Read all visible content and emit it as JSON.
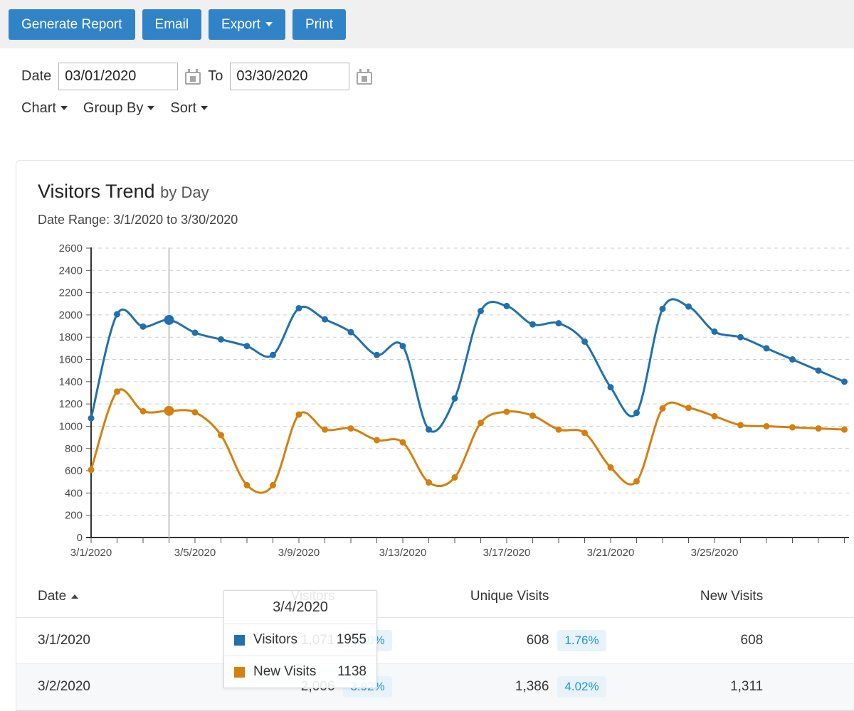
{
  "toolbar": {
    "buttons": [
      {
        "label": "Generate Report",
        "caret": false
      },
      {
        "label": "Email",
        "caret": false
      },
      {
        "label": "Export",
        "caret": true
      },
      {
        "label": "Print",
        "caret": false
      }
    ]
  },
  "filters": {
    "date_label": "Date",
    "date_from": "03/01/2020",
    "to_label": "To",
    "date_to": "03/30/2020",
    "date_placeholder": "mm/dd/yyyy",
    "menus": [
      {
        "label": "Chart"
      },
      {
        "label": "Group By"
      },
      {
        "label": "Sort"
      }
    ]
  },
  "card": {
    "title_main": "Visitors Trend",
    "title_sub": "by Day",
    "range_text": "Date Range: 3/1/2020 to 3/30/2020"
  },
  "tooltip": {
    "date": "3/4/2020",
    "rows": [
      {
        "name": "Visitors",
        "value": "1955",
        "color": "#2170ae"
      },
      {
        "name": "New Visits",
        "value": "1138",
        "color": "#d4800e"
      }
    ]
  },
  "colors": {
    "visitors": "#2170ae",
    "new_visits": "#d4800e",
    "button": "#3183c8",
    "toolbar_bg": "#f0f0f0",
    "badge_bg": "#e8f2fb",
    "badge_text": "#2196d3",
    "grid": "#cccccc",
    "axis": "#333333"
  },
  "chart_data": {
    "type": "line",
    "title": "Visitors Trend by Day",
    "subtitle": "Date Range: 3/1/2020 to 3/30/2020",
    "xlabel": "",
    "ylabel": "",
    "ylim": [
      0,
      2600
    ],
    "ytick_step": 200,
    "yticks": [
      0,
      200,
      400,
      600,
      800,
      1000,
      1200,
      1400,
      1600,
      1800,
      2000,
      2200,
      2400,
      2600
    ],
    "grid": true,
    "legend": "tooltip",
    "x": [
      "3/1/2020",
      "3/2/2020",
      "3/3/2020",
      "3/4/2020",
      "3/5/2020",
      "3/6/2020",
      "3/7/2020",
      "3/8/2020",
      "3/9/2020",
      "3/10/2020",
      "3/11/2020",
      "3/12/2020",
      "3/13/2020",
      "3/14/2020",
      "3/15/2020",
      "3/16/2020",
      "3/17/2020",
      "3/18/2020",
      "3/19/2020",
      "3/20/2020",
      "3/21/2020",
      "3/22/2020",
      "3/23/2020",
      "3/24/2020",
      "3/25/2020",
      "3/26/2020",
      "3/27/2020",
      "3/28/2020",
      "3/29/2020",
      "3/30/2020"
    ],
    "xtick_labels": [
      "3/1/2020",
      "3/5/2020",
      "3/9/2020",
      "3/13/2020",
      "3/17/2020",
      "3/21/2020",
      "3/25/2020"
    ],
    "xtick_indices": [
      0,
      4,
      8,
      12,
      16,
      20,
      24
    ],
    "series": [
      {
        "name": "Visitors",
        "color": "#2170ae",
        "values": [
          1071,
          2006,
          1895,
          1955,
          1840,
          1780,
          1720,
          1640,
          2060,
          1960,
          1845,
          1640,
          1720,
          970,
          1250,
          2035,
          2080,
          1915,
          1925,
          1760,
          1350,
          1120,
          2055,
          2075,
          1850,
          1800,
          1700,
          1600,
          1500,
          1400
        ]
      },
      {
        "name": "New Visits",
        "color": "#d4800e",
        "values": [
          608,
          1311,
          1135,
          1138,
          1125,
          920,
          470,
          470,
          1105,
          970,
          980,
          875,
          855,
          495,
          540,
          1030,
          1130,
          1095,
          970,
          940,
          630,
          505,
          1160,
          1165,
          1090,
          1010,
          1000,
          990,
          980,
          970
        ]
      }
    ],
    "highlight_index": 3,
    "crosshair_x_index": 3
  },
  "table": {
    "columns": [
      {
        "key": "date",
        "label": "Date",
        "sorted": "asc"
      },
      {
        "key": "visitors",
        "label": "Visitors"
      },
      {
        "key": "unique",
        "label": "Unique Visits"
      },
      {
        "key": "newvisits",
        "label": "New Visits"
      }
    ],
    "rows": [
      {
        "date": "3/1/2020",
        "visitors": "1,071",
        "visitors_pct": "2.10%",
        "unique": "608",
        "unique_pct": "1.76%",
        "newvisits": "608"
      },
      {
        "date": "3/2/2020",
        "visitors": "2,006",
        "visitors_pct": "3.92%",
        "unique": "1,386",
        "unique_pct": "4.02%",
        "newvisits": "1,311"
      }
    ]
  }
}
